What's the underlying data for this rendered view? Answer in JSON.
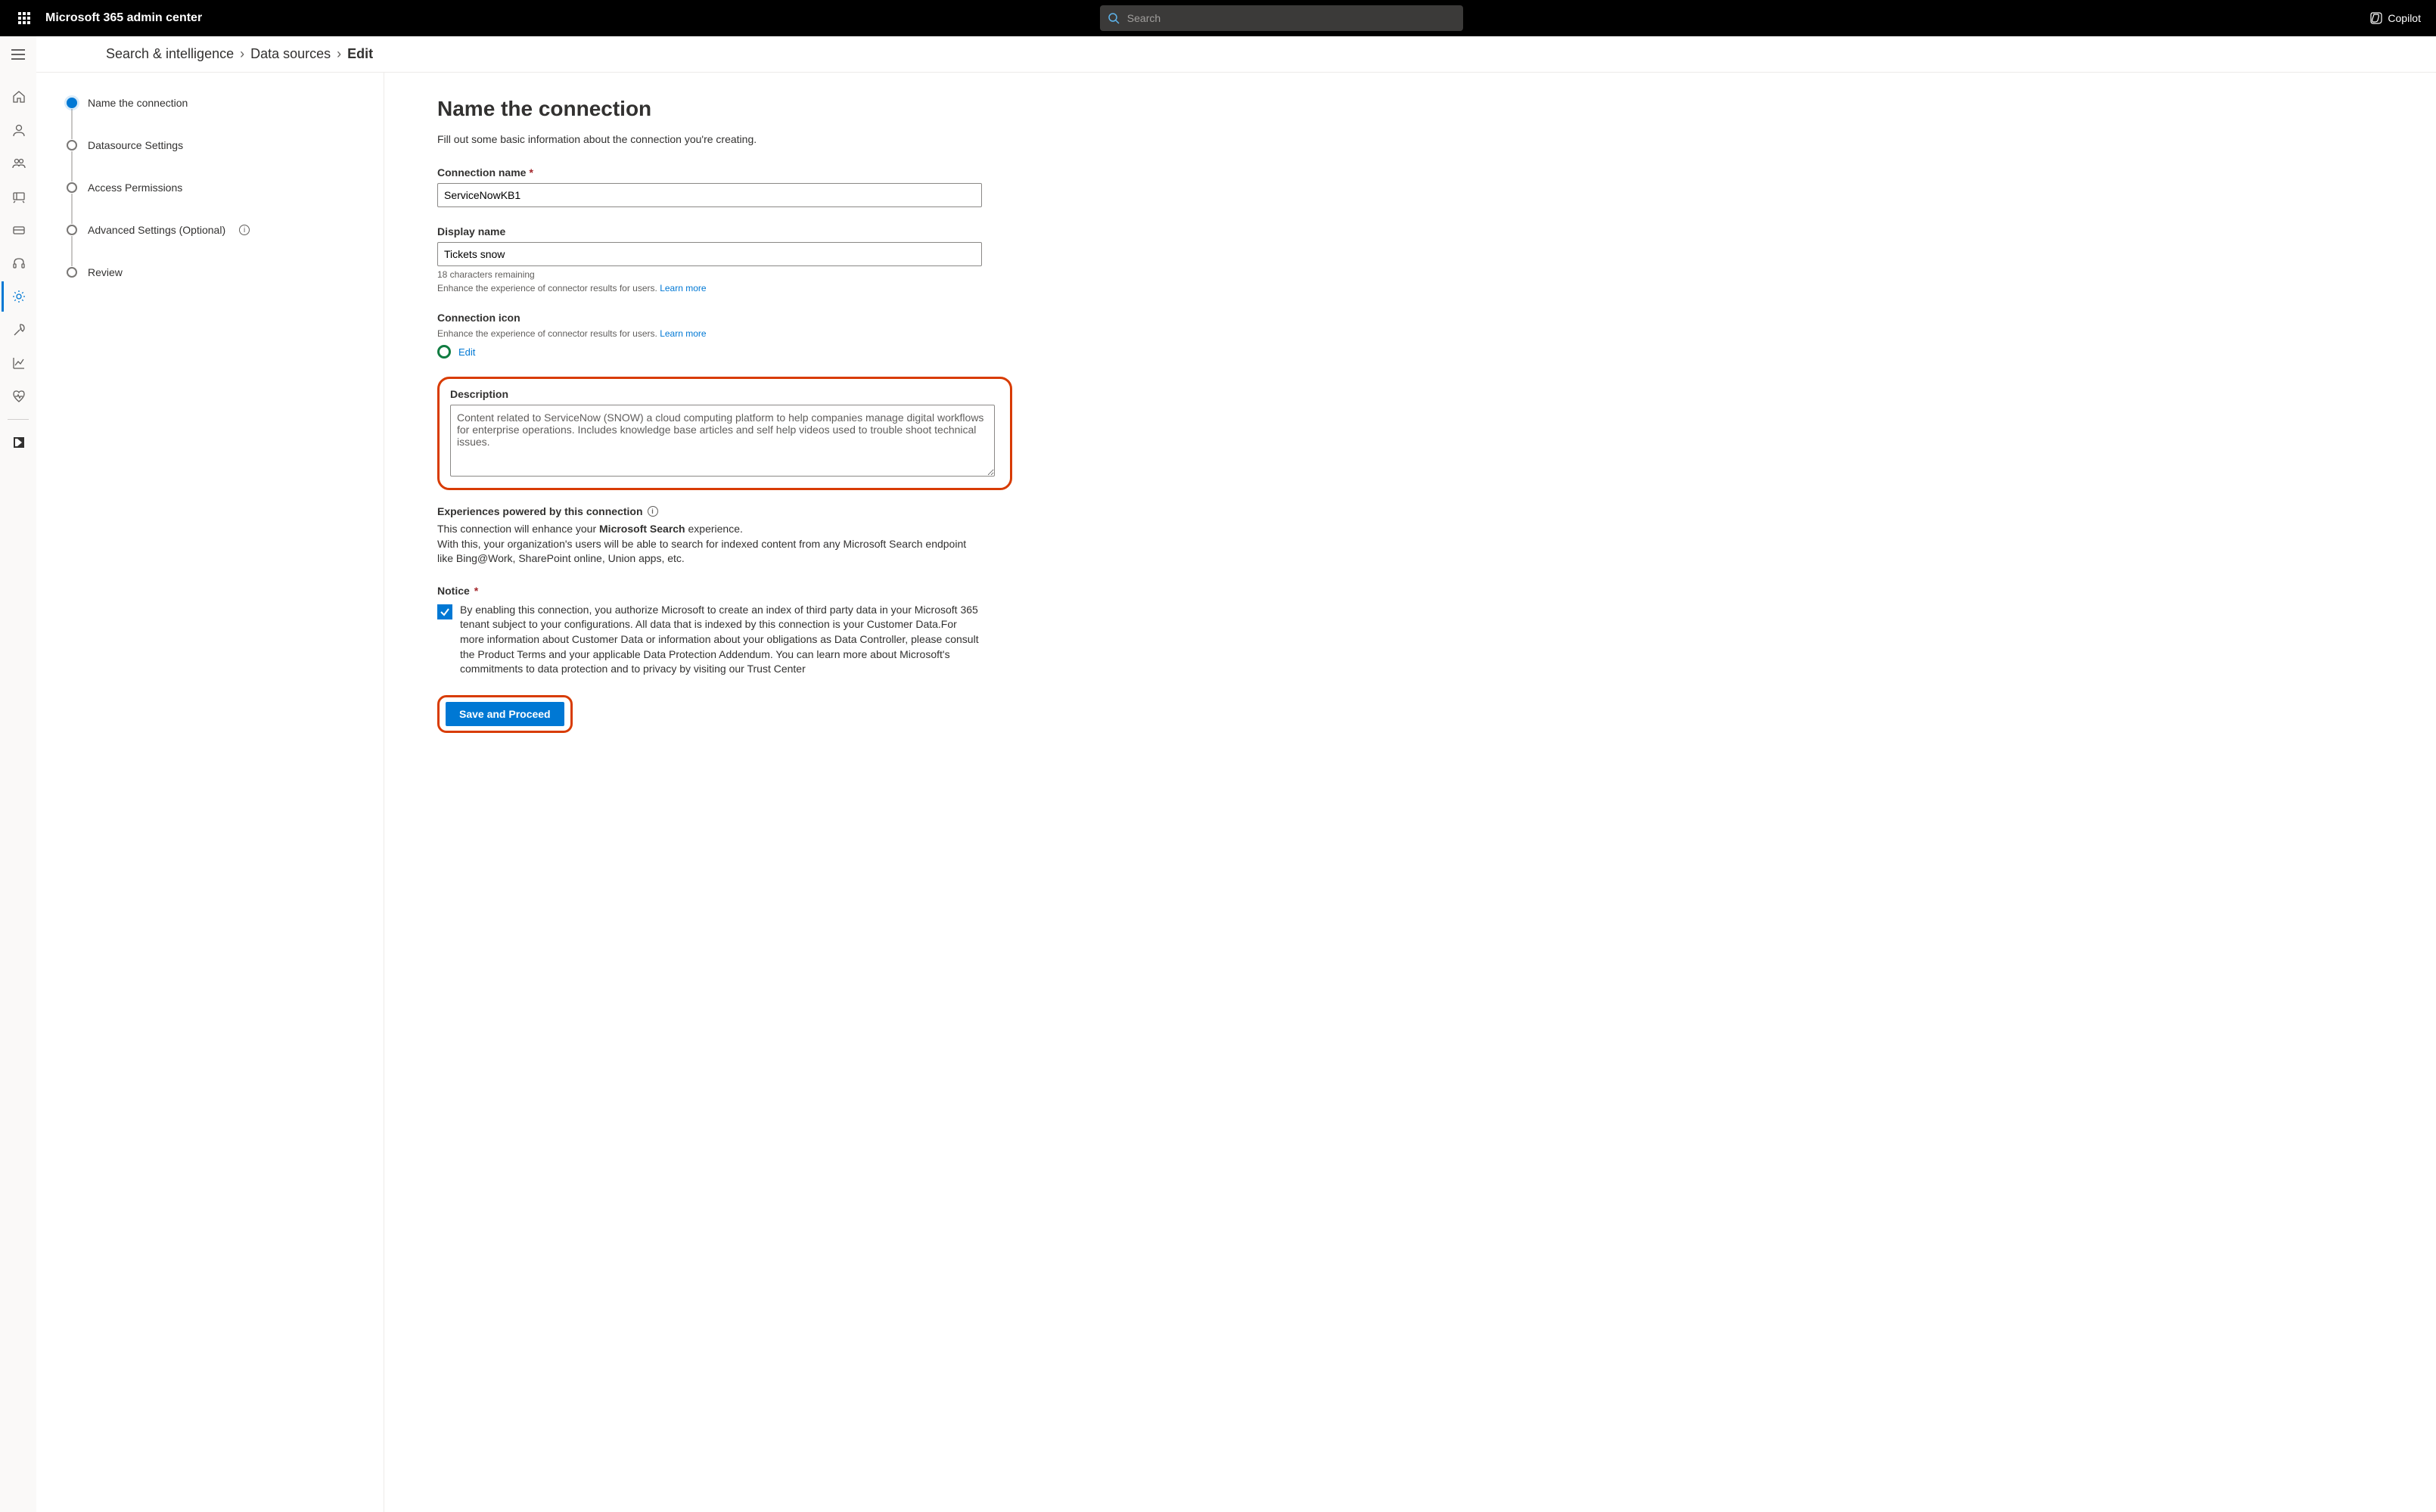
{
  "header": {
    "app_title": "Microsoft 365 admin center",
    "search_placeholder": "Search",
    "copilot_label": "Copilot"
  },
  "breadcrumb": {
    "items": [
      "Search & intelligence",
      "Data sources",
      "Edit"
    ]
  },
  "stepper": {
    "steps": [
      {
        "label": "Name the connection",
        "current": true
      },
      {
        "label": "Datasource Settings"
      },
      {
        "label": "Access Permissions"
      },
      {
        "label": "Advanced Settings (Optional)",
        "info": true
      },
      {
        "label": "Review"
      }
    ]
  },
  "form": {
    "heading": "Name the connection",
    "subtitle": "Fill out some basic information about the connection you're creating.",
    "connection_name": {
      "label": "Connection name",
      "value": "ServiceNowKB1"
    },
    "display_name": {
      "label": "Display name",
      "value": "Tickets snow",
      "remaining_text": "18 characters remaining",
      "enhance_text": "Enhance the experience of connector results for users.",
      "learn_more": "Learn more"
    },
    "connection_icon": {
      "label": "Connection icon",
      "enhance_text": "Enhance the experience of connector results for users.",
      "learn_more": "Learn more",
      "edit_label": "Edit"
    },
    "description": {
      "label": "Description",
      "value": "Content related to ServiceNow (SNOW) a cloud computing platform to help companies manage digital workflows for enterprise operations. Includes knowledge base articles and self help videos used to trouble shoot technical issues."
    },
    "experiences": {
      "label": "Experiences powered by this connection",
      "line1_a": "This connection will enhance your ",
      "line1_b": "Microsoft Search",
      "line1_c": " experience.",
      "line2": "With this, your organization's users will be able to search for indexed content from any Microsoft Search endpoint like Bing@Work, SharePoint online, Union apps, etc."
    },
    "notice": {
      "label": "Notice",
      "text": "By enabling this connection, you authorize Microsoft to create an index of third party data in your Microsoft 365 tenant subject to your configurations. All data that is indexed by this connection is your Customer Data.For more information about Customer Data or information about your obligations as Data Controller, please consult the Product Terms and your applicable Data Protection Addendum. You can learn more about Microsoft's commitments to data protection and to privacy by visiting our Trust Center"
    },
    "save_button": "Save and Proceed"
  }
}
